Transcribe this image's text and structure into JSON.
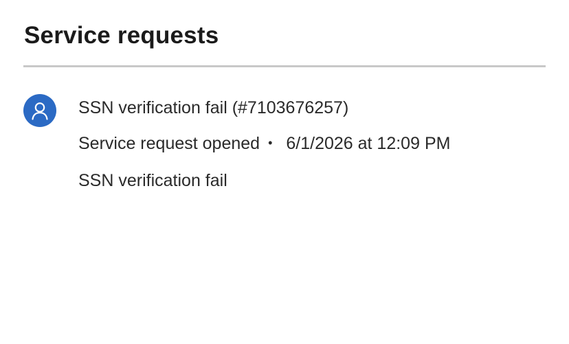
{
  "page": {
    "title": "Service requests"
  },
  "requests": [
    {
      "avatar_icon": "person-icon",
      "title": "SSN verification fail (#7103676257)",
      "status": "Service request opened",
      "separator": "•",
      "datetime": "6/1/2026 at 12:09 PM",
      "description": "SSN verification fail"
    }
  ],
  "colors": {
    "avatar_background": "#2b6ac4",
    "divider": "#c8c8c8",
    "text": "#2a2a2a"
  }
}
